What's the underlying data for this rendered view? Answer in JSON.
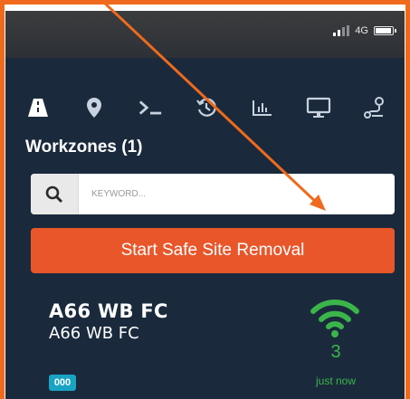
{
  "status_bar": {
    "network": "4G",
    "signal_icon": "signal-bars-icon",
    "battery_icon": "battery-icon"
  },
  "toolbar": {
    "icons": [
      "road-icon",
      "map-pin-icon",
      "terminal-icon",
      "history-icon",
      "chart-icon",
      "monitor-icon",
      "route-icon"
    ]
  },
  "workzones": {
    "title": "Workzones (1)"
  },
  "search": {
    "placeholder": "KEYWORD..."
  },
  "actions": {
    "start_label": "Start Safe Site Removal"
  },
  "workzone_card": {
    "name": "A66 WB FC",
    "subtitle": "A66 WB FC",
    "badge": "000",
    "count": "3",
    "last_seen": "just now",
    "status_icon": "wifi-icon"
  },
  "colors": {
    "background": "#1a2a3c",
    "accent": "#e8562a",
    "status_green": "#3bb54a",
    "badge": "#19a4c4",
    "annotation": "#ef6a1c"
  }
}
